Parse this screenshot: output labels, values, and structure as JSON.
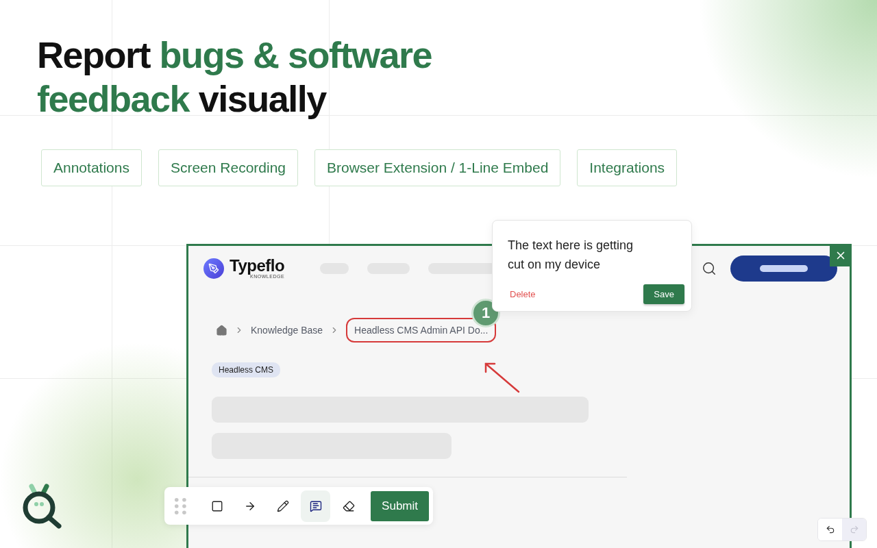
{
  "headline": {
    "lines": [
      [
        {
          "text": "Report ",
          "accent": false
        },
        {
          "text": "bugs & software",
          "accent": true
        }
      ],
      [
        {
          "text": "feedback",
          "accent": true
        },
        {
          "text": " visually",
          "accent": false
        }
      ]
    ]
  },
  "features": [
    "Annotations",
    "Screen Recording",
    "Browser Extension / 1-Line Embed",
    "Integrations"
  ],
  "preview": {
    "brand": {
      "name": "Typeflo",
      "tagline": "KNOWLEDGE"
    },
    "breadcrumb": [
      {
        "label": "Knowledge Base",
        "highlighted": false
      },
      {
        "label": "Headless CMS Admin API Do...",
        "highlighted": true
      }
    ],
    "tag": "Headless CMS"
  },
  "comment": {
    "text": "The text here is getting cut on my device",
    "delete": "Delete",
    "save": "Save",
    "marker": "1"
  },
  "toolbar": {
    "tools": [
      {
        "kind": "rectangle",
        "selected": false
      },
      {
        "kind": "arrow",
        "selected": false
      },
      {
        "kind": "pencil",
        "selected": false
      },
      {
        "kind": "comment",
        "selected": true
      },
      {
        "kind": "eraser",
        "selected": false
      }
    ],
    "submit": "Submit"
  },
  "history": {
    "undo": {
      "disabled": false
    },
    "redo": {
      "disabled": true
    }
  }
}
